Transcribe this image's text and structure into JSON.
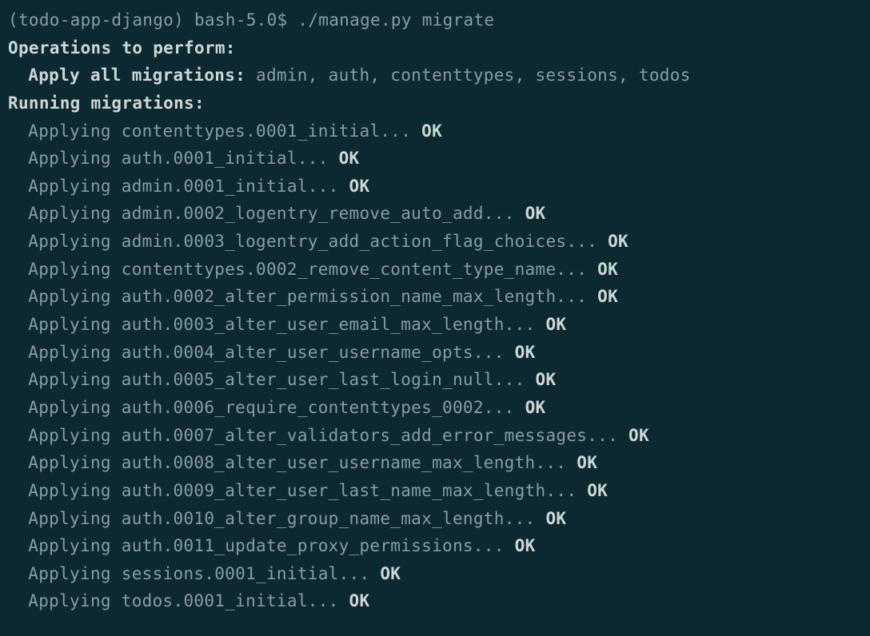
{
  "prompt": {
    "prefix": "(todo-app-django) bash-5.0$ ",
    "command": "./manage.py migrate"
  },
  "headers": {
    "operations": "Operations to perform:",
    "apply_all_label": "Apply all migrations: ",
    "apply_all_targets": "admin, auth, contenttypes, sessions, todos",
    "running": "Running migrations:"
  },
  "apply_word": "Applying ",
  "ok_word": "OK",
  "migrations": [
    "contenttypes.0001_initial... ",
    "auth.0001_initial... ",
    "admin.0001_initial... ",
    "admin.0002_logentry_remove_auto_add... ",
    "admin.0003_logentry_add_action_flag_choices... ",
    "contenttypes.0002_remove_content_type_name... ",
    "auth.0002_alter_permission_name_max_length... ",
    "auth.0003_alter_user_email_max_length... ",
    "auth.0004_alter_user_username_opts... ",
    "auth.0005_alter_user_last_login_null... ",
    "auth.0006_require_contenttypes_0002... ",
    "auth.0007_alter_validators_add_error_messages... ",
    "auth.0008_alter_user_username_max_length... ",
    "auth.0009_alter_user_last_name_max_length... ",
    "auth.0010_alter_group_name_max_length... ",
    "auth.0011_update_proxy_permissions... ",
    "sessions.0001_initial... ",
    "todos.0001_initial... "
  ]
}
